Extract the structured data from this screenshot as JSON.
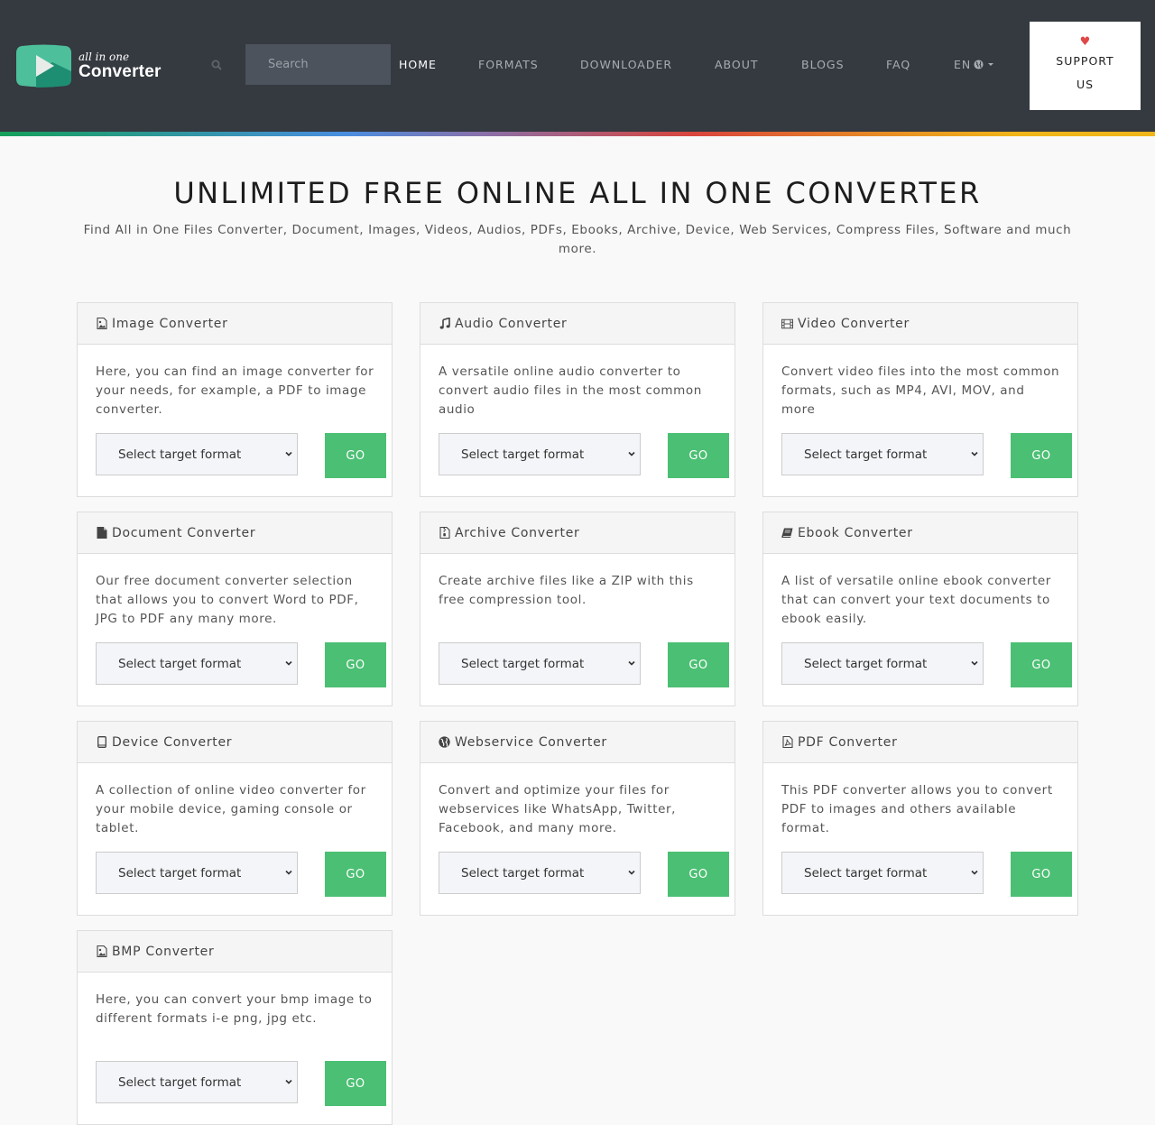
{
  "header": {
    "logo": {
      "small_text": "all in one",
      "big_text": "Converter"
    },
    "search": {
      "placeholder": "Search",
      "value": ""
    },
    "nav": [
      {
        "label": "HOME",
        "active": true
      },
      {
        "label": "FORMATS",
        "active": false
      },
      {
        "label": "DOWNLOADER",
        "active": false
      },
      {
        "label": "ABOUT",
        "active": false
      },
      {
        "label": "BLOGS",
        "active": false
      },
      {
        "label": "FAQ",
        "active": false
      }
    ],
    "language": {
      "label": "EN",
      "icon": "globe-icon"
    },
    "support": {
      "icon": "heart-icon",
      "line1": "SUPPORT",
      "line2": "US"
    }
  },
  "colors": {
    "header_bg": "#353940",
    "accent_green": "#4bbf73",
    "heart_red": "#e04848",
    "logo_teal": "#4dbf9b",
    "logo_dark_teal": "#1d8e72"
  },
  "hero": {
    "title": "UNLIMITED FREE ONLINE ALL IN ONE CONVERTER",
    "subtitle": "Find All in One Files Converter, Document, Images, Videos, Audios, PDFs, Ebooks, Archive, Device, Web Services, Compress Files, Software and much more."
  },
  "cards": [
    {
      "icon": "image-file-icon",
      "title": "Image Converter",
      "description": "Here, you can find an image converter for your needs, for example, a PDF to image converter.",
      "select_value": "Select target format",
      "button": "GO"
    },
    {
      "icon": "music-icon",
      "title": "Audio Converter",
      "description": "A versatile online audio converter to convert audio files in the most common audio",
      "select_value": "Select target format",
      "button": "GO"
    },
    {
      "icon": "film-icon",
      "title": "Video Converter",
      "description": "Convert video files into the most common formats, such as MP4, AVI, MOV, and more",
      "select_value": "Select target format",
      "button": "GO"
    },
    {
      "icon": "document-icon",
      "title": "Document Converter",
      "description": "Our free document converter selection that allows you to convert Word to PDF, JPG to PDF any many more.",
      "select_value": "Select target format",
      "button": "GO"
    },
    {
      "icon": "archive-file-icon",
      "title": "Archive Converter",
      "description": "Create archive files like a ZIP with this free compression tool.",
      "select_value": "Select target format",
      "button": "GO"
    },
    {
      "icon": "book-icon",
      "title": "Ebook Converter",
      "description": "A list of versatile online ebook converter that can convert your text documents to ebook easily.",
      "select_value": "Select target format",
      "button": "GO"
    },
    {
      "icon": "tablet-icon",
      "title": "Device Converter",
      "description": "A collection of online video converter for your mobile device, gaming console or tablet.",
      "select_value": "Select target format",
      "button": "GO"
    },
    {
      "icon": "globe-icon",
      "title": "Webservice Converter",
      "description": "Convert and optimize your files for webservices like WhatsApp, Twitter, Facebook, and many more.",
      "select_value": "Select target format",
      "button": "GO"
    },
    {
      "icon": "pdf-file-icon",
      "title": "PDF Converter",
      "description": "This PDF converter allows you to convert PDF to images and others available format.",
      "select_value": "Select target format",
      "button": "GO"
    },
    {
      "icon": "image-file-icon",
      "title": "BMP Converter",
      "description": "Here, you can convert your bmp image to different formats i-e png, jpg etc.",
      "select_value": "Select target format",
      "button": "GO"
    }
  ]
}
